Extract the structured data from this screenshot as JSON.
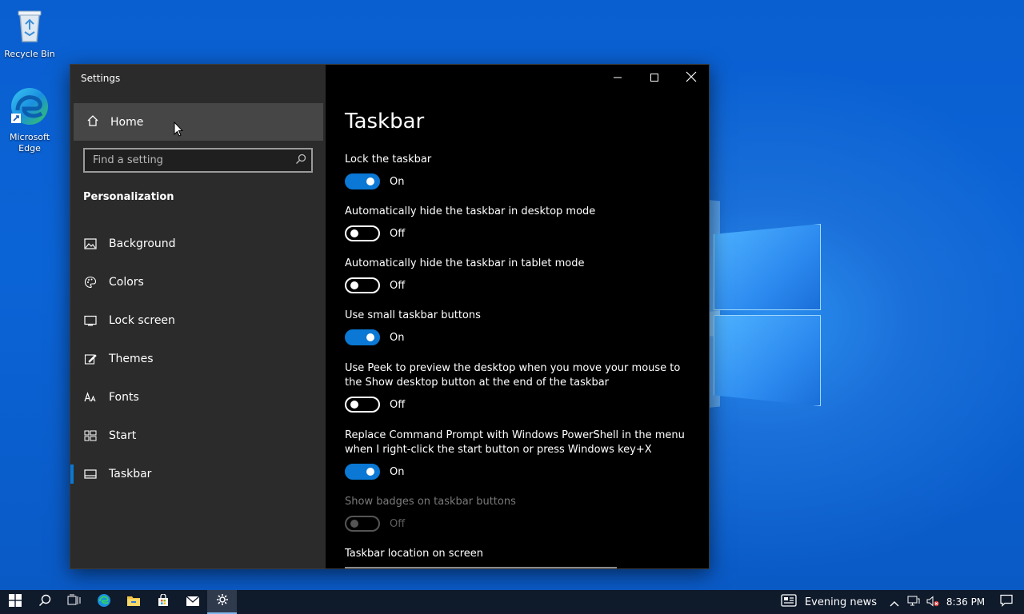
{
  "desktop": {
    "icons": [
      {
        "label": "Recycle Bin",
        "icon": "recycle-bin-icon"
      },
      {
        "label": "Microsoft Edge",
        "icon": "edge-icon"
      }
    ]
  },
  "window": {
    "title": "Settings",
    "controls": [
      "minimize-icon",
      "maximize-icon",
      "close-icon"
    ]
  },
  "nav": {
    "home_label": "Home",
    "search_placeholder": "Find a setting",
    "section": "Personalization",
    "items": [
      {
        "label": "Background",
        "icon": "image-icon"
      },
      {
        "label": "Colors",
        "icon": "palette-icon"
      },
      {
        "label": "Lock screen",
        "icon": "lock-screen-icon"
      },
      {
        "label": "Themes",
        "icon": "themes-icon"
      },
      {
        "label": "Fonts",
        "icon": "fonts-icon"
      },
      {
        "label": "Start",
        "icon": "start-layout-icon"
      },
      {
        "label": "Taskbar",
        "icon": "taskbar-icon",
        "active": true
      }
    ]
  },
  "content": {
    "title": "Taskbar",
    "options": [
      {
        "label": "Lock the taskbar",
        "state": "On",
        "enabled": true
      },
      {
        "label": "Automatically hide the taskbar in desktop mode",
        "state": "Off",
        "enabled": true
      },
      {
        "label": "Automatically hide the taskbar in tablet mode",
        "state": "Off",
        "enabled": true
      },
      {
        "label": "Use small taskbar buttons",
        "state": "On",
        "enabled": true
      },
      {
        "label": "Use Peek to preview the desktop when you move your mouse to the Show desktop button at the end of the taskbar",
        "state": "Off",
        "enabled": true
      },
      {
        "label": "Replace Command Prompt with Windows PowerShell in the menu when I right-click the start button or press Windows key+X",
        "state": "On",
        "enabled": true
      },
      {
        "label": "Show badges on taskbar buttons",
        "state": "Off",
        "enabled": false
      }
    ],
    "location_label": "Taskbar location on screen"
  },
  "taskbar": {
    "buttons": [
      "start-icon",
      "search-icon",
      "task-view-icon",
      "edge-icon",
      "file-explorer-icon",
      "store-icon",
      "mail-icon",
      "settings-icon"
    ],
    "news": "Evening news",
    "clock": "8:36 PM"
  },
  "colors": {
    "accent": "#0a78d4",
    "nav_bg": "#2b2b2b",
    "content_bg": "#000000"
  }
}
